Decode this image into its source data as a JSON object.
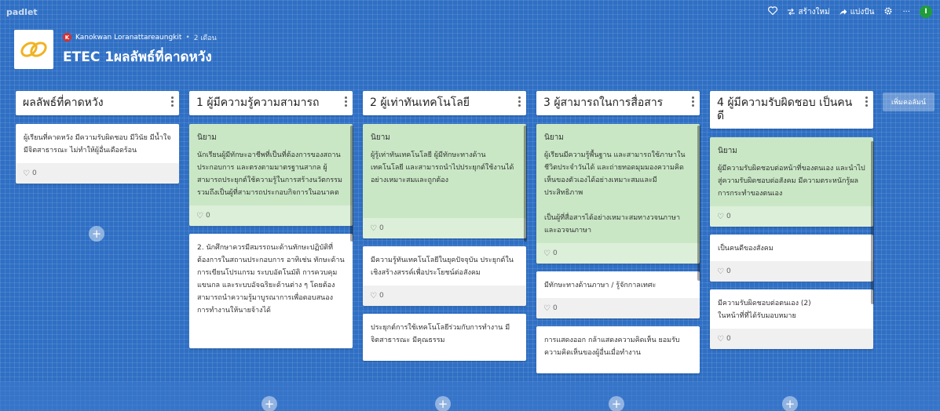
{
  "app": {
    "brand": "padlet"
  },
  "topbar": {
    "heart_icon": "heart-icon",
    "remix_label": "สร้างใหม่",
    "share_label": "แบ่งปัน",
    "more_label": "···",
    "avatar_initial": "I"
  },
  "board": {
    "author_initial": "K",
    "author": "Kanokwan Loranattareaungkit",
    "separator": "•",
    "age": "2 เดือน",
    "title": "ETEC 1ผลลัพธ์ที่คาดหวัง"
  },
  "add_column_label": "เพิ่มคอลัมน์",
  "add_post_label": "+",
  "colors": {
    "background": "#2f6fc4",
    "green_post": "#c9e7c5",
    "avatar": "#1f9d3a",
    "author_badge": "#d9302c"
  },
  "columns": [
    {
      "title": "ผลลัพธ์ที่คาดหวัง",
      "posts": [
        {
          "title": "",
          "text": "ผู้เรียนที่คาดหวัง มีความรับผิดชอบ มีวินัย มีน้ำใจ มีจิตสาธารณะ ไม่ทำให้ผู้อื่นเดือดร้อน",
          "likes": "0"
        }
      ]
    },
    {
      "title": "1 ผู้มีความรู้ความสามารถ",
      "posts": [
        {
          "title": "นิยาม",
          "text": "นักเรียนผู้มีทักษะอาชีพที่เป็นที่ต้องการของสถานประกอบการ และตรงตามมาตรฐานสากล ผู้สามารถประยุกต์ใช้ความรู้ในการสร้างนวัตกรรม รวมถึงเป็นผู้ที่สามารถประกอบกิจการในอนาคต",
          "likes": "0"
        },
        {
          "title": "",
          "text": "2. นักศึกษาควรมีสมรรถนะด้านทักษะปฏิบัติที่ต้องการในสถานประกอบการ อาทิเช่น ทักษะด้านการเขียนโปรแกรม ระบบอัตโนมัติ การควบคุมแขนกล และระบบอัจฉริยะด้านต่าง ๆ โดยต้องสามารถนำความรู้มาบูรณาการเพื่อตอบสนองการทำงานให้นายจ้างได้",
          "likes": ""
        }
      ]
    },
    {
      "title": "2 ผู้เท่าทันเทคโนโลยี",
      "posts": [
        {
          "title": "นิยาม",
          "text": "ผู้รู้เท่าทันเทคโนโลยี ผู้มีทักษะทางด้านเทคโนโลยี และสามารถนำไปประยุกต์ใช้งานได้อย่างเหมาะสมและถูกต้อง",
          "likes": "0"
        },
        {
          "title": "",
          "text": "มีความรู้ทันเทคโนโลยีในยุคปัจจุบัน ประยุกต์ในเชิงสร้างสรรค์เพื่อประโยชน์ต่อสังคม",
          "likes": "0"
        },
        {
          "title": "",
          "text": "ประยุกต์การใช้เทคโนโลยีร่วมกับการทำงาน มีจิตสาธารณะ มีคุณธรรม",
          "likes": ""
        }
      ]
    },
    {
      "title": "3 ผู้สามารถในการสื่อสาร",
      "posts": [
        {
          "title": "นิยาม",
          "text": "ผู้เรียนมีความรู้พื้นฐาน และสามารถใช้ภาษาในชีวิตประจำวันได้ และถ่ายทอดมุมมองความคิดเห็นของตัวเองได้อย่างเหมาะสมและมีประสิทธิภาพ\n\nเป็นผู้ที่สื่อสารได้อย่างเหมาะสมทางวจนภาษาและอวจนภาษา",
          "likes": "0"
        },
        {
          "title": "",
          "text": "มีทักษะทางด้านภาษา / รู้จักกาลเทศะ",
          "likes": "0"
        },
        {
          "title": "",
          "text": "การแสดงออก กล้าแสดงความคิดเห็น ยอมรับความคิดเห็นของผู้อื่นเมื่อทำงาน",
          "likes": ""
        }
      ]
    },
    {
      "title": "4 ผู้มีความรับผิดชอบ เป็นคนดี",
      "posts": [
        {
          "title": "นิยาม",
          "text": "ผู้มีความรับผิดชอบต่อหน้าที่ของตนเอง และนำไปสู่ความรับผิดชอบต่อสังคม มีความตระหนักรู้ผลการกระทำของตนเอง",
          "likes": "0"
        },
        {
          "title": "",
          "text": "เป็นคนดีของสังคม",
          "likes": "0"
        },
        {
          "title": "",
          "text": "มีความรับผิดชอบต่อตนเอง (2)\nในหน้าที่ที่ได้รับมอบหมาย",
          "likes": "0"
        }
      ]
    }
  ]
}
